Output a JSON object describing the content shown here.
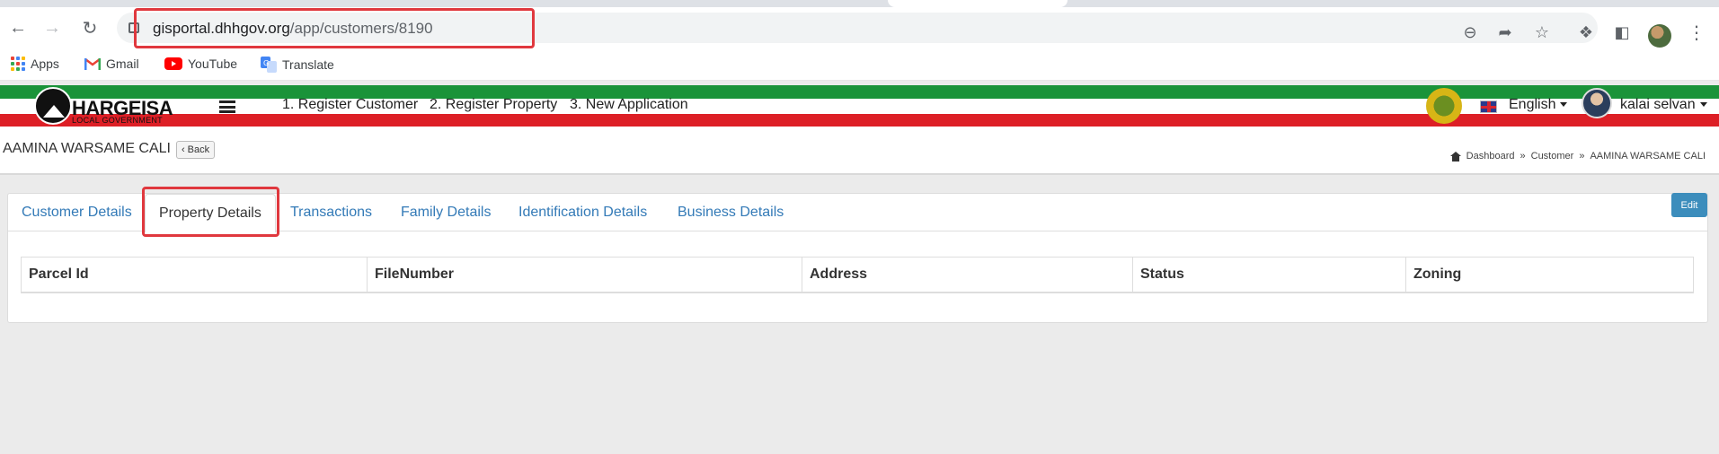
{
  "browser": {
    "url_host": "gisportal.dhhgov.org",
    "url_path": "/app/customers/8190",
    "bookmarks": [
      {
        "label": "Apps"
      },
      {
        "label": "Gmail"
      },
      {
        "label": "YouTube"
      },
      {
        "label": "Translate"
      }
    ]
  },
  "app": {
    "brand": "HARGEISA",
    "brand_sub": "LOCAL GOVERNMENT",
    "nav": [
      {
        "label": "1. Register Customer"
      },
      {
        "label": "2. Register Property"
      },
      {
        "label": "3. New Application"
      }
    ],
    "language": "English",
    "user": "kalai selvan"
  },
  "page": {
    "customer_name": "AAMINA WARSAME CALI",
    "back_label": "Back",
    "breadcrumb": [
      "Dashboard",
      "Customer",
      "AAMINA WARSAME CALI"
    ]
  },
  "tabs": [
    {
      "label": "Customer Details"
    },
    {
      "label": "Property Details",
      "active": true
    },
    {
      "label": "Transactions"
    },
    {
      "label": "Family Details"
    },
    {
      "label": "Identification Details"
    },
    {
      "label": "Business Details"
    }
  ],
  "edit_label": "Edit",
  "table": {
    "columns": [
      "Parcel Id",
      "FileNumber",
      "Address",
      "Status",
      "Zoning"
    ]
  },
  "colors": {
    "accent": "#3c8dbc",
    "link": "#337ab7",
    "highlight": "#e0383e",
    "stripe_green": "#1a9339",
    "stripe_red": "#dd1f26"
  }
}
